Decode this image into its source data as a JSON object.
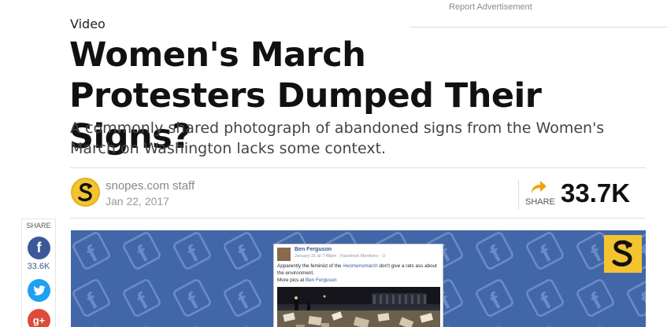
{
  "header": {
    "report_ad": "Report Advertisement"
  },
  "article": {
    "category": "Video",
    "title": "Women's March Protesters Dumped Their Signs?",
    "subtitle": "A commonly shared photograph of abandoned signs from the Women's March on Washington lacks some context."
  },
  "byline": {
    "author": "snopes.com staff",
    "date": "Jan 22, 2017",
    "avatar_icon": "snopes-logo-icon"
  },
  "share": {
    "label": "SHARE",
    "total_count": "33.7K",
    "icon": "share-arrow-icon",
    "accent_color": "#f0a30a"
  },
  "share_sidebar": {
    "label": "SHARE",
    "facebook_count": "33.6K",
    "facebook_glyph": "f",
    "google_glyph": "g+",
    "colors": {
      "facebook": "#3b5998",
      "twitter": "#1da1f2",
      "google": "#dd4b39"
    }
  },
  "hero": {
    "background_color": "#4267a8",
    "badge_color": "#f4c430",
    "post": {
      "name": "Ben Ferguson",
      "meta": "January 21 at 7:48pm · Facebook Mentions · ⊙",
      "text_before": "Apparently the feminist of the ",
      "hashtag": "#womensmarch",
      "text_after": " don't give a rats ass about the environment.",
      "more_prefix": "More pics at ",
      "more_link": "Ben Ferguson"
    }
  }
}
